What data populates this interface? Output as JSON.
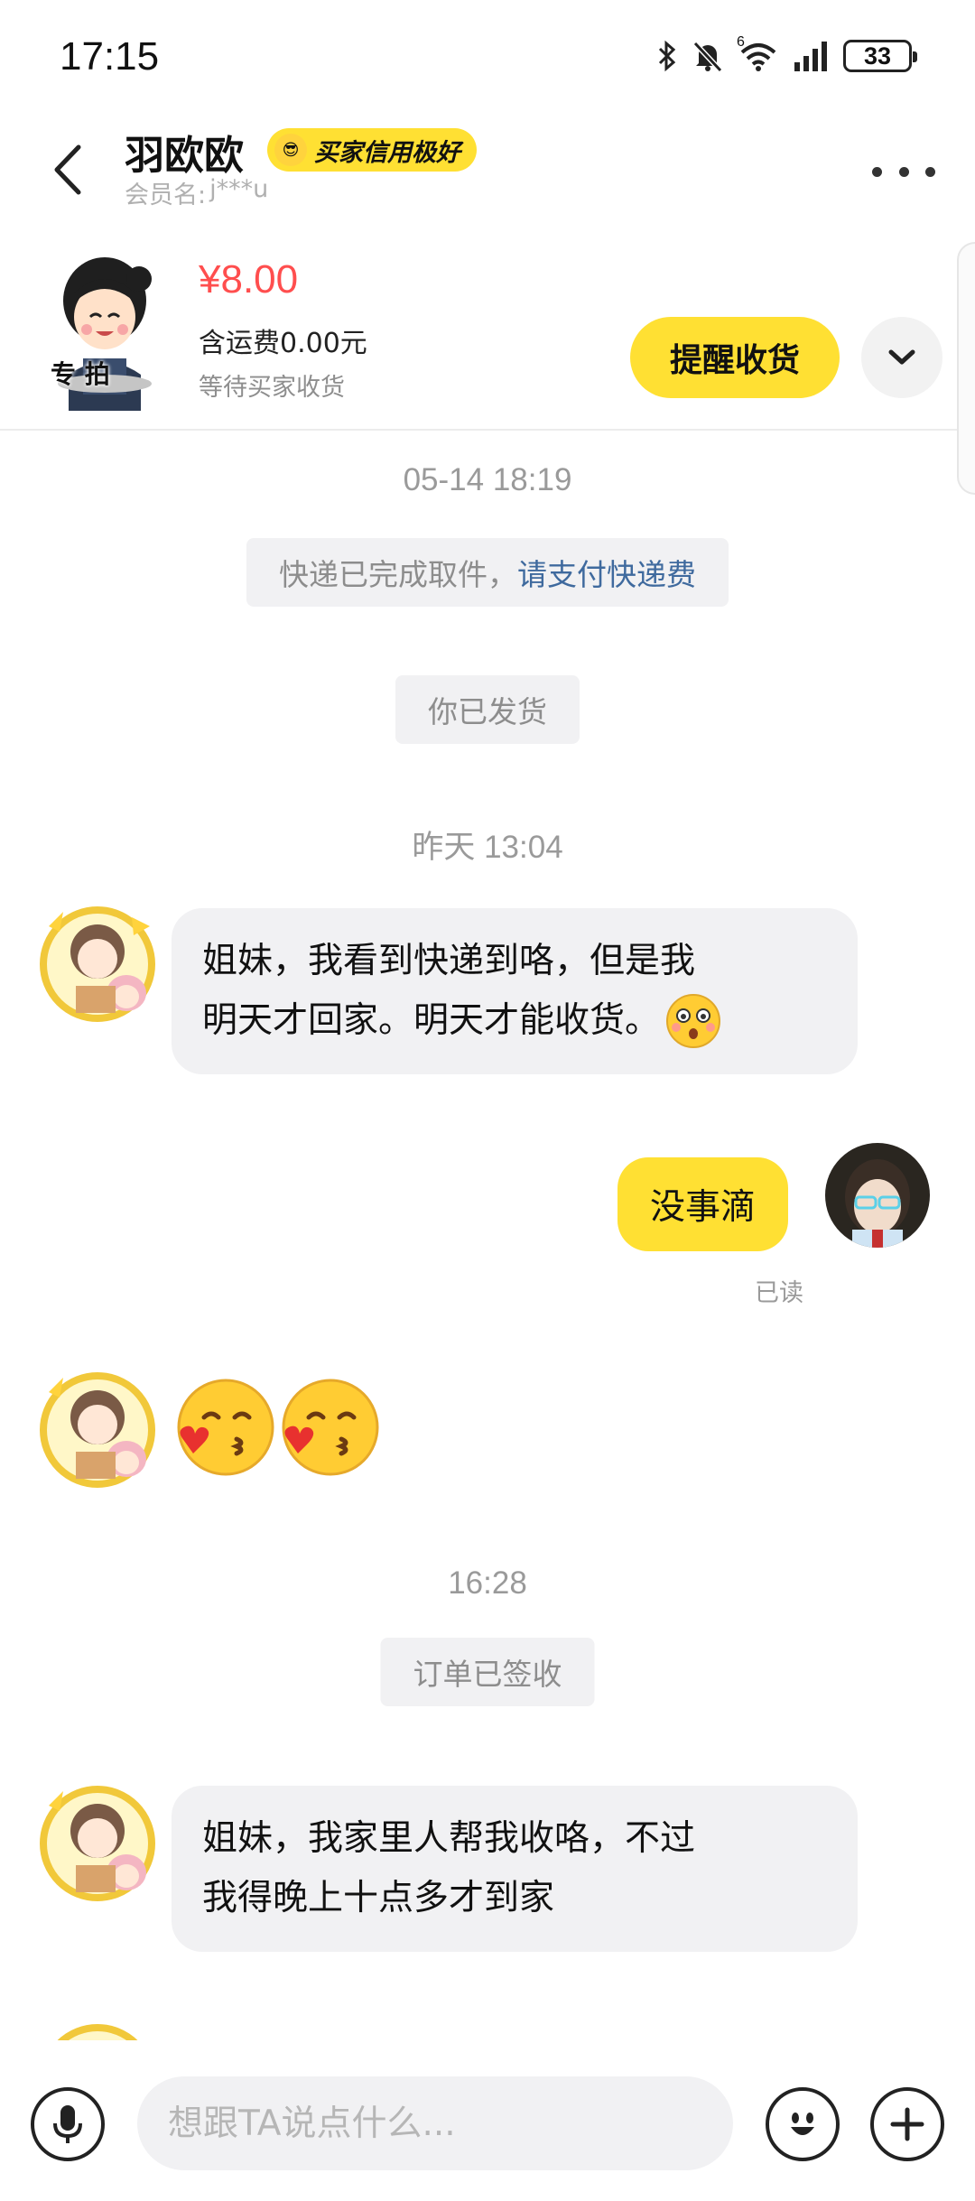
{
  "status_bar": {
    "time": "17:15",
    "battery": "33",
    "signal_label": "6"
  },
  "header": {
    "user_name": "羽欧欧",
    "credit_badge": "买家信用极好",
    "member_label": "会员名:",
    "member_value": "j***u"
  },
  "order": {
    "thumb_label": "专 拍",
    "price": "¥8.00",
    "shipping": "含运费0.00元",
    "status": "等待买家收货",
    "remind_button": "提醒收货"
  },
  "chat": {
    "ts1": "05-14 18:19",
    "sys1_text": "快递已完成取件，",
    "sys1_link": "请支付快递费",
    "sys2": "你已发货",
    "ts2": "昨天 13:04",
    "msg1_line1": "姐妹，我看到快递到咯，但是我",
    "msg1_line2": "明天才回家。明天才能收货。",
    "msg2": "没事滴",
    "read_label": "已读",
    "ts3": "16:28",
    "sys3": "订单已签收",
    "msg3_line1": "姐妹，我家里人帮我收咯，不过",
    "msg3_line2": "我得晚上十点多才到家"
  },
  "input": {
    "placeholder": "想跟TA说点什么..."
  },
  "icons": {
    "back": "back-arrow-icon",
    "more": "more-dots-icon",
    "expand": "chevron-down-icon",
    "mic": "microphone-icon",
    "emoji": "emoji-icon",
    "plus": "plus-icon"
  },
  "colors": {
    "accent": "#ffe033",
    "price": "#ff4e4e",
    "link": "#3f6a9e",
    "bubble": "#f1f1f3"
  }
}
